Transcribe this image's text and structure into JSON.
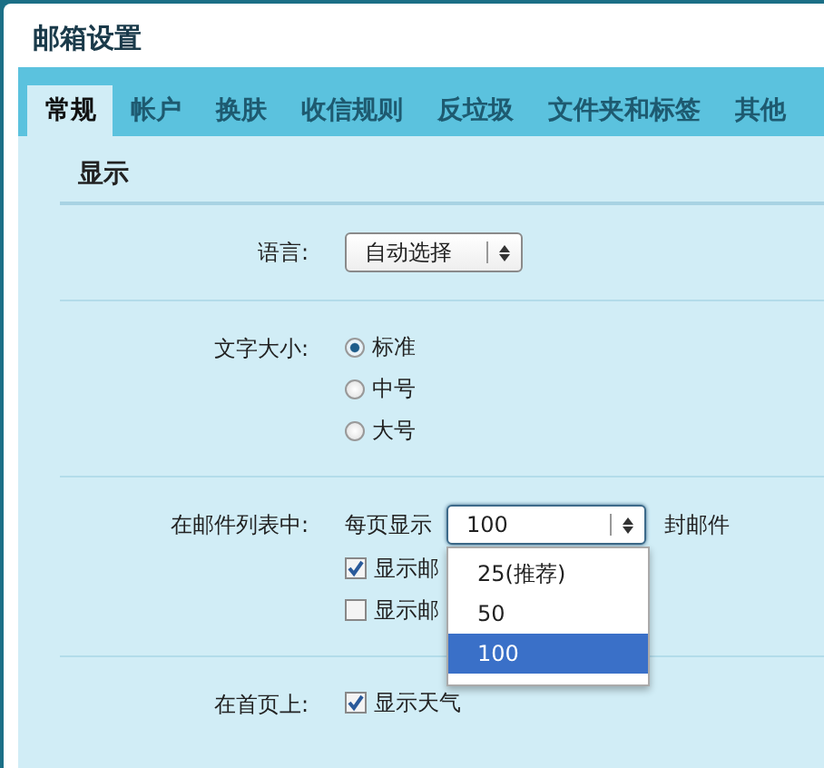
{
  "window": {
    "title": "邮箱设置"
  },
  "tabs": [
    {
      "label": "常规",
      "selected": true
    },
    {
      "label": "帐户",
      "selected": false
    },
    {
      "label": "换肤",
      "selected": false
    },
    {
      "label": "收信规则",
      "selected": false
    },
    {
      "label": "反垃圾",
      "selected": false
    },
    {
      "label": "文件夹和标签",
      "selected": false
    },
    {
      "label": "其他",
      "selected": false
    }
  ],
  "section": {
    "title": "显示"
  },
  "language": {
    "label": "语言:",
    "value": "自动选择"
  },
  "font_size": {
    "label": "文字大小:",
    "options": [
      {
        "label": "标准",
        "selected": true
      },
      {
        "label": "中号",
        "selected": false
      },
      {
        "label": "大号",
        "selected": false
      }
    ]
  },
  "mail_list": {
    "label": "在邮件列表中:",
    "prefix": "每页显示",
    "value": "100",
    "suffix": "封邮件",
    "expanded": true,
    "options": [
      {
        "label": "25(推荐)",
        "selected": false
      },
      {
        "label": "50",
        "selected": false
      },
      {
        "label": "100",
        "selected": true
      }
    ],
    "checkboxes": [
      {
        "label": "显示邮",
        "checked": true
      },
      {
        "label": "显示邮",
        "checked": false
      }
    ]
  },
  "home_page": {
    "label": "在首页上:",
    "checkboxes": [
      {
        "label": "显示天气",
        "checked": true
      }
    ]
  }
}
